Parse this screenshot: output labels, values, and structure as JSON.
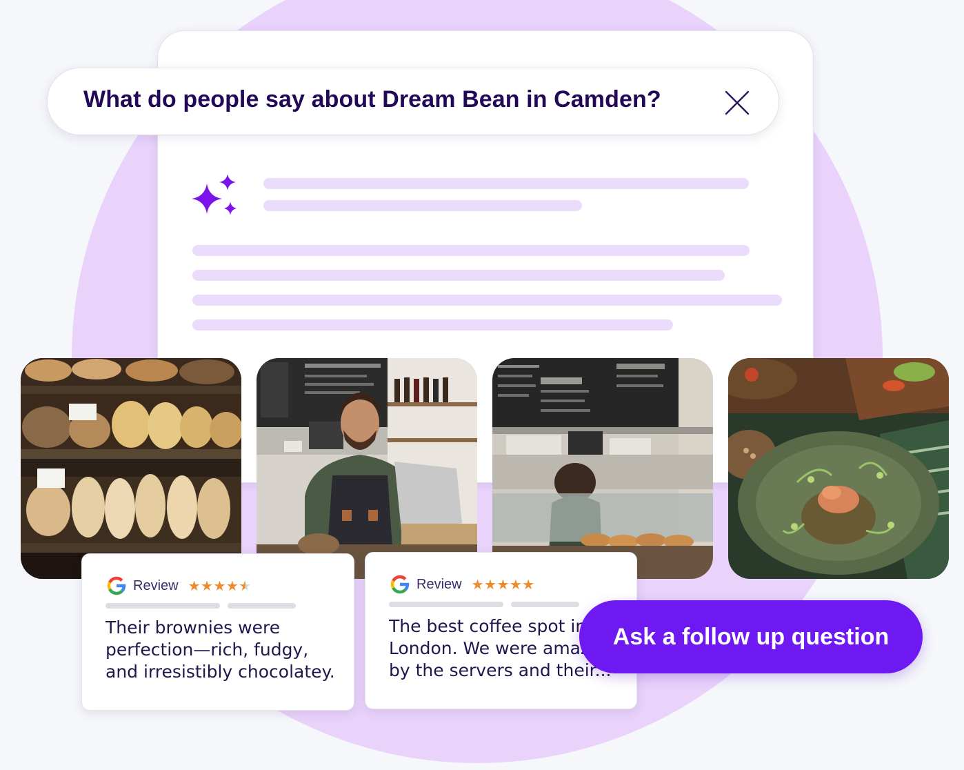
{
  "search": {
    "question": "What do people say about Dream Bean in Camden?"
  },
  "answer": {
    "icon": "sparkle-icon",
    "accent_color": "#7a14ea",
    "placeholder_color": "#ecdcfb"
  },
  "photos": [
    {
      "name": "bakery-bread-shelves-photo"
    },
    {
      "name": "barista-at-counter-photo"
    },
    {
      "name": "cafe-counter-chalkboard-photo"
    },
    {
      "name": "plated-dish-photo"
    }
  ],
  "reviews": [
    {
      "label": "Review",
      "rating": 4.5,
      "text": "Their brownies were\nperfection—rich, fudgy,\nand irresistibly chocolatey."
    },
    {
      "label": "Review",
      "rating": 5,
      "text": "The best coffee spot in\nLondon. We were amazed\nby the servers and their..."
    }
  ],
  "follow_up": {
    "label": "Ask a follow up question",
    "color": "#6f19f2"
  }
}
